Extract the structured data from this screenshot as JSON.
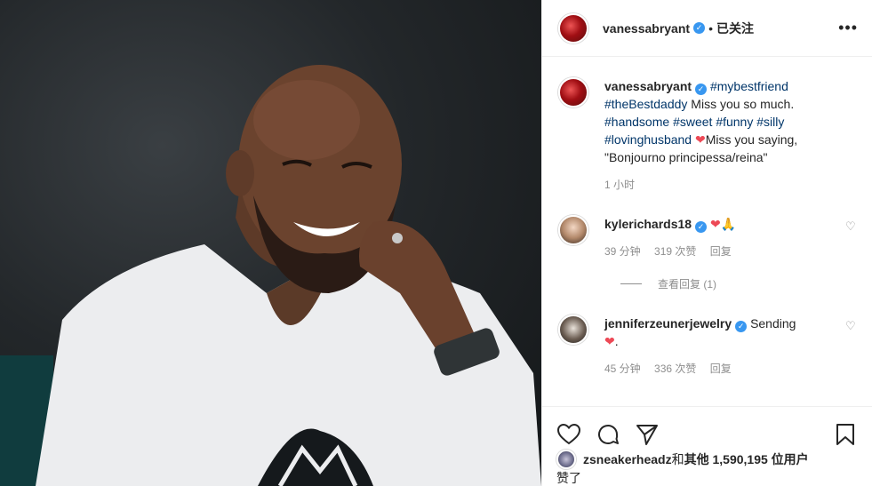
{
  "post_author": {
    "username": "vanessabryant",
    "separator": "•",
    "follow_status": "已关注",
    "more_label": "•••"
  },
  "caption": {
    "username": "vanessabryant",
    "hashtag_1": "#mybestfriend",
    "hashtag_2": "#theBestdaddy",
    "text_1": " Miss you so much.",
    "hashtag_3": "#handsome",
    "hashtag_4": "#sweet",
    "hashtag_5": "#funny",
    "hashtag_6": "#silly",
    "hashtag_7": "#lovinghusband",
    "text_2": "Miss you saying,",
    "text_3": "\"Bonjourno principessa/reina\"",
    "time": "1 小时"
  },
  "comments": [
    {
      "username": "kylerichards18",
      "emoji": "🙏",
      "time": "39 分钟",
      "likes": "319 次赞",
      "reply": "回复",
      "view_replies": "查看回复 (1)"
    },
    {
      "username": "jenniferzeunerjewelry",
      "text": "Sending",
      "suffix": ".",
      "time": "45 分钟",
      "likes": "336 次赞",
      "reply": "回复"
    }
  ],
  "likes_summary": {
    "username": "zsneakerheadz",
    "and": " 和 ",
    "others": "其他 1,590,195 位用户",
    "liked": "赞了"
  },
  "colors": {
    "link": "#003569",
    "verified": "#3897f0",
    "heart": "#ed4956",
    "muted": "#8e8e8e"
  }
}
